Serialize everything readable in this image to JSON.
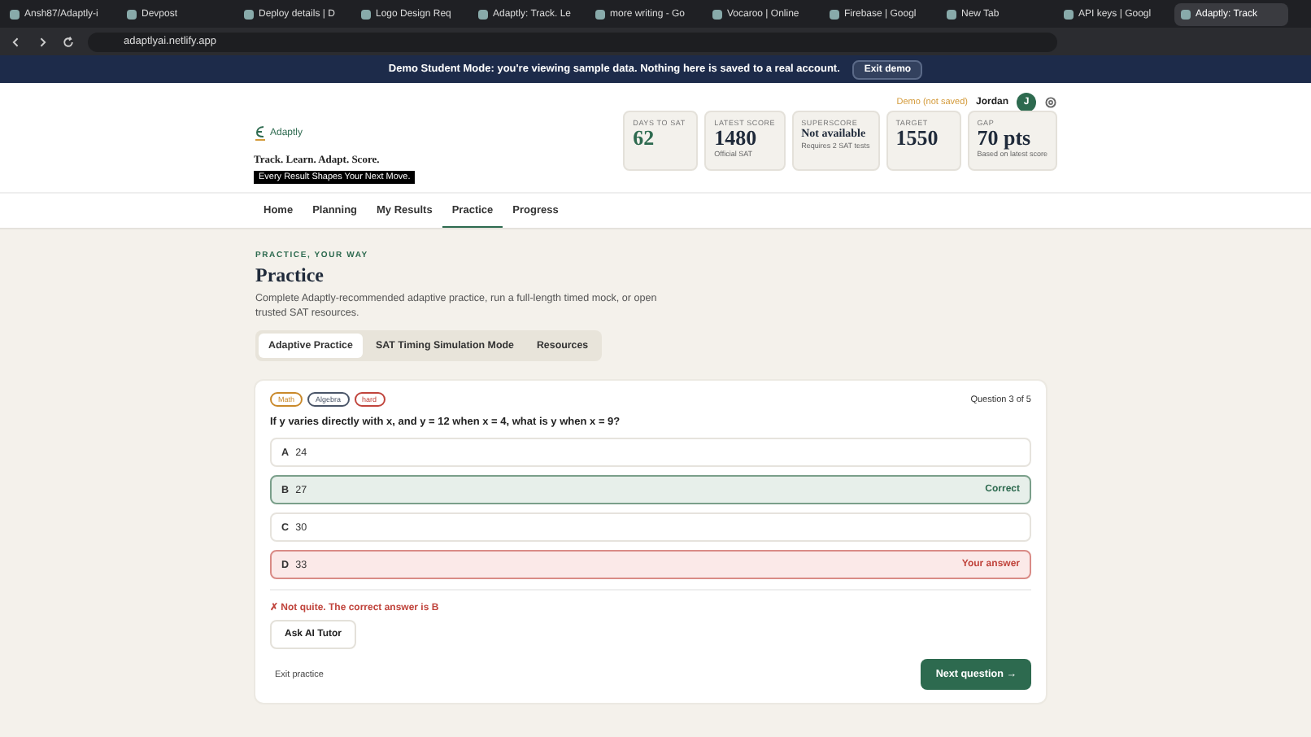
{
  "browser": {
    "tabs": [
      {
        "label": "Ansh87/Adaptly-i",
        "selected": false
      },
      {
        "label": "Devpost",
        "selected": false
      },
      {
        "label": "Deploy details | D",
        "selected": false
      },
      {
        "label": "Logo Design Req",
        "selected": false
      },
      {
        "label": "Adaptly: Track. Le",
        "selected": false
      },
      {
        "label": "more writing - Go",
        "selected": false
      },
      {
        "label": "Vocaroo | Online",
        "selected": false
      },
      {
        "label": "Firebase | Googl",
        "selected": false
      },
      {
        "label": "New Tab",
        "selected": false
      },
      {
        "label": "API keys | Googl",
        "selected": false
      },
      {
        "label": "Adaptly: Track",
        "selected": true
      }
    ],
    "address": "adaptlyai.netlify.app"
  },
  "banner": {
    "text": "Demo Student Mode: you're viewing sample data. Nothing here is saved to a real account.",
    "button": "Exit demo"
  },
  "header": {
    "status": "Demo (not saved)",
    "user": "Jordan",
    "avatar": "J",
    "logo": "Adaptly",
    "tagline": "Track. Learn. Adapt. Score.",
    "motto": "Every Result Shapes Your Next Move.",
    "stats": [
      {
        "label": "DAYS TO SAT",
        "value": "62",
        "accent": true
      },
      {
        "label": "LATEST SCORE",
        "value": "1480",
        "note": "Official SAT",
        "accent": false
      },
      {
        "label": "SUPERSCORE",
        "value": "Not available",
        "note": "Requires 2 SAT tests",
        "accent": false
      },
      {
        "label": "TARGET",
        "value": "1550",
        "accent": false
      },
      {
        "label": "GAP",
        "value": "70 pts",
        "note": "Based on latest score",
        "accent": false
      }
    ]
  },
  "nav": [
    {
      "label": "Home",
      "selected": false
    },
    {
      "label": "Planning",
      "selected": false
    },
    {
      "label": "My Results",
      "selected": false
    },
    {
      "label": "Practice",
      "selected": true
    },
    {
      "label": "Progress",
      "selected": false
    }
  ],
  "page": {
    "eyebrow": "PRACTICE, YOUR WAY",
    "title": "Practice",
    "description": "Complete Adaptly-recommended adaptive practice, run a full-length timed mock, or open trusted SAT resources.",
    "modes": [
      {
        "label": "Adaptive Practice",
        "selected": true
      },
      {
        "label": "SAT Timing Simulation Mode",
        "selected": false
      },
      {
        "label": "Resources",
        "selected": false
      }
    ]
  },
  "question": {
    "tags": [
      {
        "label": "Math",
        "color": "#c9892a"
      },
      {
        "label": "Algebra",
        "color": "#4a5568"
      },
      {
        "label": "hard",
        "color": "#c0443c"
      }
    ],
    "counter": "Question 3 of 5",
    "prompt": "If y varies directly with x, and y = 12 when x = 4, what is y when x = 9?",
    "choices": [
      {
        "letter": "A",
        "text": "24",
        "correct": false,
        "selected": false
      },
      {
        "letter": "B",
        "text": "27",
        "correct": true,
        "selected": false,
        "note": "Correct"
      },
      {
        "letter": "C",
        "text": "30",
        "correct": false,
        "selected": false
      },
      {
        "letter": "D",
        "text": "33",
        "correct": false,
        "selected": true,
        "note": "Your answer"
      }
    ],
    "feedback": "✗ Not quite. The correct answer is B",
    "tutor": "Ask AI Tutor",
    "exit": "Exit practice",
    "next": "Next question →"
  }
}
